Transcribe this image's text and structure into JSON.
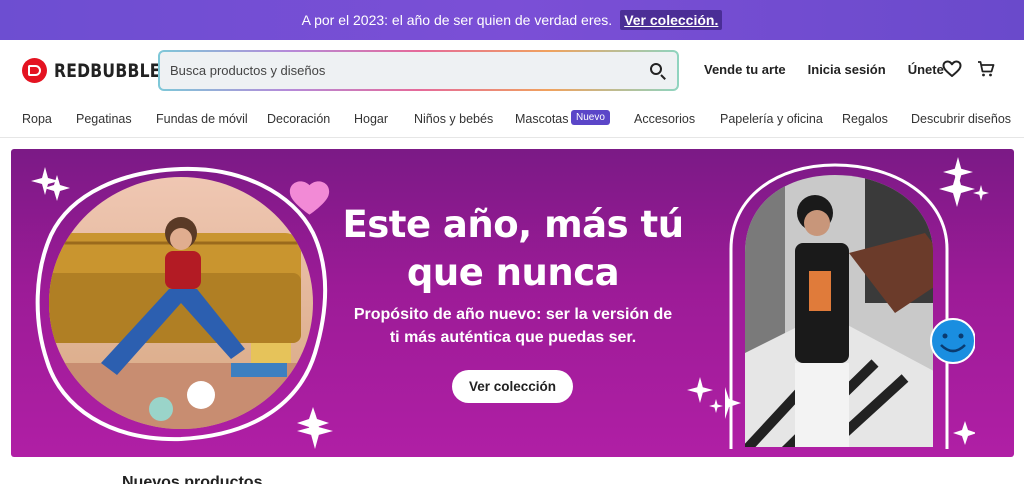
{
  "promo": {
    "message": "A por el 2023: el año de ser quien de verdad eres.",
    "link": "Ver colección."
  },
  "header": {
    "logo_text": "REDBUBBLE",
    "search_placeholder": "Busca productos y diseños",
    "links": [
      "Vende tu arte",
      "Inicia sesión",
      "Únete"
    ],
    "icons": [
      "heart-icon",
      "cart-icon",
      "search-icon"
    ]
  },
  "nav": {
    "items": [
      "Ropa",
      "Pegatinas",
      "Fundas de móvil",
      "Decoración",
      "Hogar",
      "Niños y bebés",
      "Mascotas",
      "Accesorios",
      "Papelería y oficina",
      "Regalos",
      "Descubrir diseños"
    ],
    "badge": "Nuevo"
  },
  "hero": {
    "title_line1": "Este año, más tú",
    "title_line2": "que nunca",
    "subtitle_line1": "Propósito de año nuevo: ser la versión de",
    "subtitle_line2": "ti más auténtica que puedas ser.",
    "button": "Ver colección",
    "colors": {
      "background_top": "#7b1a86",
      "background_bottom": "#b01fa5",
      "brand": "#e41321",
      "accent": "#5b46c8"
    }
  },
  "below_heading": "Nuevos productos"
}
